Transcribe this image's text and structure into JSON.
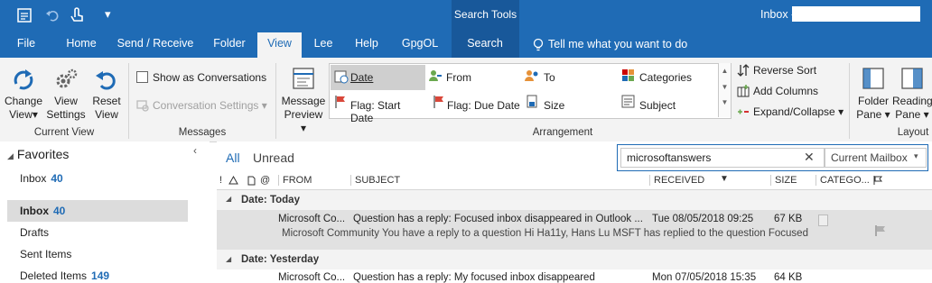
{
  "titlebar": {
    "search_tools": "Search Tools",
    "inbox_prefix": "Inbox -"
  },
  "tabs": [
    "File",
    "Home",
    "Send / Receive",
    "Folder",
    "View",
    "Lee",
    "Help",
    "GpgOL",
    "Search"
  ],
  "tell_me": "Tell me what you want to do",
  "ribbon": {
    "change_view": [
      "Change",
      "View"
    ],
    "view_settings": [
      "View",
      "Settings"
    ],
    "reset_view": [
      "Reset",
      "View"
    ],
    "current_view_group": "Current View",
    "show_as_conversations": "Show as Conversations",
    "conversation_settings": "Conversation Settings",
    "messages_group": "Messages",
    "message_preview": [
      "Message",
      "Preview"
    ],
    "arrangement_items": [
      "Date",
      "From",
      "To",
      "Categories",
      "Flag: Start Date",
      "Flag: Due Date",
      "Size",
      "Subject"
    ],
    "arrangement_group": "Arrangement",
    "reverse_sort": "Reverse Sort",
    "add_columns": "Add Columns",
    "expand_collapse": "Expand/Collapse",
    "folder_pane": [
      "Folder",
      "Pane"
    ],
    "reading_pane": [
      "Reading",
      "Pane"
    ],
    "layout_group": "Layout"
  },
  "nav": {
    "favorites": "Favorites",
    "fav_inbox": "Inbox",
    "fav_inbox_count": "40",
    "inbox": "Inbox",
    "inbox_count": "40",
    "drafts": "Drafts",
    "sent": "Sent Items",
    "deleted": "Deleted Items",
    "deleted_count": "149"
  },
  "filter": {
    "all": "All",
    "unread": "Unread"
  },
  "search": {
    "value": "microsoftanswers",
    "scope": "Current Mailbox"
  },
  "columns": [
    "FROM",
    "SUBJECT",
    "RECEIVED",
    "SIZE",
    "CATEGO..."
  ],
  "groups": [
    "Date: Today",
    "Date: Yesterday"
  ],
  "messages": [
    {
      "from": "Microsoft Co...",
      "subject": "Question has a reply: Focused inbox disappeared in Outlook ...",
      "received": "Tue 08/05/2018 09:25",
      "size": "67 KB",
      "preview": "Microsoft Community  You have a reply to a question  Hi Ha11y,  Hans Lu MSFT has replied to the question Focused"
    },
    {
      "from": "Microsoft Co...",
      "subject": "Question has a reply: My focused inbox disappeared",
      "received": "Mon 07/05/2018 15:35",
      "size": "64 KB"
    }
  ],
  "colors": {
    "brand": "#1f6bb5",
    "ribbon": "#f3f3f3",
    "selected_row": "#e1e1e1"
  }
}
